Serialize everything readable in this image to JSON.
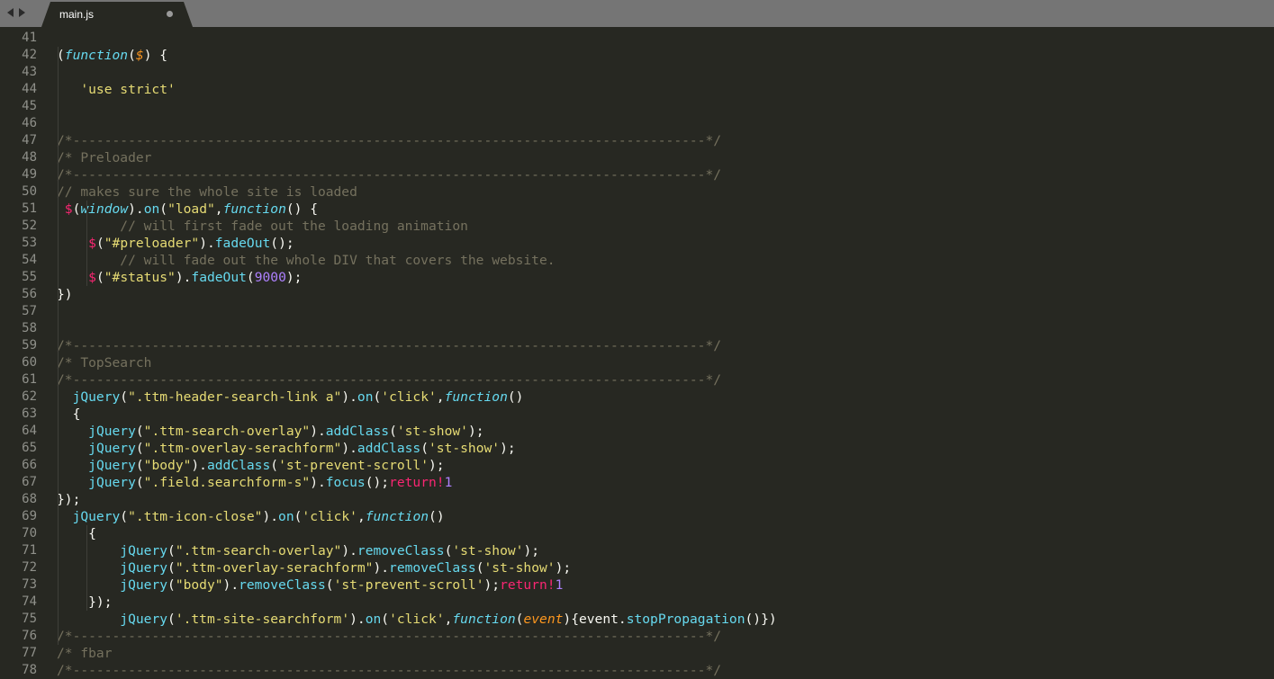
{
  "tab": {
    "title": "main.js",
    "modified_indicator": "●"
  },
  "nav": {
    "back_icon": "chevron-left-icon",
    "forward_icon": "chevron-right-icon"
  },
  "theme": {
    "background": "#272822",
    "tabbar": "#757575",
    "comment": "#75715e",
    "string": "#e6db74",
    "keyword": "#66d9ef",
    "operator": "#f92672",
    "number": "#ae81ff",
    "param": "#fd971f"
  },
  "lines": [
    {
      "n": "41",
      "tokens": []
    },
    {
      "n": "42",
      "tokens": [
        [
          "t",
          "("
        ],
        [
          "k",
          "function"
        ],
        [
          "t",
          "("
        ],
        [
          "p",
          "$"
        ],
        [
          "t",
          ") {"
        ]
      ]
    },
    {
      "n": "43",
      "tokens": []
    },
    {
      "n": "44",
      "tokens": [
        [
          "t",
          "   "
        ],
        [
          "s",
          "'use strict'"
        ]
      ]
    },
    {
      "n": "45",
      "tokens": []
    },
    {
      "n": "46",
      "tokens": []
    },
    {
      "n": "47",
      "tokens": [
        [
          "c",
          "/*--------------------------------------------------------------------------------*/"
        ]
      ]
    },
    {
      "n": "48",
      "tokens": [
        [
          "c",
          "/* Preloader"
        ]
      ]
    },
    {
      "n": "49",
      "tokens": [
        [
          "c",
          "/*--------------------------------------------------------------------------------*/"
        ]
      ]
    },
    {
      "n": "50",
      "tokens": [
        [
          "c",
          "// makes sure the whole site is loaded"
        ]
      ]
    },
    {
      "n": "51",
      "tokens": [
        [
          "t",
          " "
        ],
        [
          "o",
          "$"
        ],
        [
          "t",
          "("
        ],
        [
          "k",
          "window"
        ],
        [
          "t",
          ")."
        ],
        [
          "f",
          "on"
        ],
        [
          "t",
          "("
        ],
        [
          "s",
          "\"load\""
        ],
        [
          "t",
          ","
        ],
        [
          "k",
          "function"
        ],
        [
          "t",
          "() {"
        ]
      ]
    },
    {
      "n": "52",
      "tokens": [
        [
          "t",
          "        "
        ],
        [
          "c",
          "// will first fade out the loading animation"
        ]
      ]
    },
    {
      "n": "53",
      "tokens": [
        [
          "t",
          "    "
        ],
        [
          "o",
          "$"
        ],
        [
          "t",
          "("
        ],
        [
          "s",
          "\"#preloader\""
        ],
        [
          "t",
          ")."
        ],
        [
          "f",
          "fadeOut"
        ],
        [
          "t",
          "();"
        ]
      ]
    },
    {
      "n": "54",
      "tokens": [
        [
          "t",
          "        "
        ],
        [
          "c",
          "// will fade out the whole DIV that covers the website."
        ]
      ]
    },
    {
      "n": "55",
      "tokens": [
        [
          "t",
          "    "
        ],
        [
          "o",
          "$"
        ],
        [
          "t",
          "("
        ],
        [
          "s",
          "\"#status\""
        ],
        [
          "t",
          ")."
        ],
        [
          "f",
          "fadeOut"
        ],
        [
          "t",
          "("
        ],
        [
          "n",
          "9000"
        ],
        [
          "t",
          ");"
        ]
      ]
    },
    {
      "n": "56",
      "tokens": [
        [
          "t",
          "})"
        ]
      ]
    },
    {
      "n": "57",
      "tokens": []
    },
    {
      "n": "58",
      "tokens": []
    },
    {
      "n": "59",
      "tokens": [
        [
          "c",
          "/*--------------------------------------------------------------------------------*/"
        ]
      ]
    },
    {
      "n": "60",
      "tokens": [
        [
          "c",
          "/* TopSearch"
        ]
      ]
    },
    {
      "n": "61",
      "tokens": [
        [
          "c",
          "/*--------------------------------------------------------------------------------*/"
        ]
      ]
    },
    {
      "n": "62",
      "tokens": [
        [
          "t",
          "  "
        ],
        [
          "f",
          "jQuery"
        ],
        [
          "t",
          "("
        ],
        [
          "s",
          "\".ttm-header-search-link a\""
        ],
        [
          "t",
          ")."
        ],
        [
          "f",
          "on"
        ],
        [
          "t",
          "("
        ],
        [
          "s",
          "'click'"
        ],
        [
          "t",
          ","
        ],
        [
          "k",
          "function"
        ],
        [
          "t",
          "()"
        ]
      ]
    },
    {
      "n": "63",
      "tokens": [
        [
          "t",
          "  {"
        ]
      ]
    },
    {
      "n": "64",
      "tokens": [
        [
          "t",
          "    "
        ],
        [
          "f",
          "jQuery"
        ],
        [
          "t",
          "("
        ],
        [
          "s",
          "\".ttm-search-overlay\""
        ],
        [
          "t",
          ")."
        ],
        [
          "f",
          "addClass"
        ],
        [
          "t",
          "("
        ],
        [
          "s",
          "'st-show'"
        ],
        [
          "t",
          ");"
        ]
      ]
    },
    {
      "n": "65",
      "tokens": [
        [
          "t",
          "    "
        ],
        [
          "f",
          "jQuery"
        ],
        [
          "t",
          "("
        ],
        [
          "s",
          "\".ttm-overlay-serachform\""
        ],
        [
          "t",
          ")."
        ],
        [
          "f",
          "addClass"
        ],
        [
          "t",
          "("
        ],
        [
          "s",
          "'st-show'"
        ],
        [
          "t",
          ");"
        ]
      ]
    },
    {
      "n": "66",
      "tokens": [
        [
          "t",
          "    "
        ],
        [
          "f",
          "jQuery"
        ],
        [
          "t",
          "("
        ],
        [
          "s",
          "\"body\""
        ],
        [
          "t",
          ")."
        ],
        [
          "f",
          "addClass"
        ],
        [
          "t",
          "("
        ],
        [
          "s",
          "'st-prevent-scroll'"
        ],
        [
          "t",
          ");"
        ]
      ]
    },
    {
      "n": "67",
      "tokens": [
        [
          "t",
          "    "
        ],
        [
          "f",
          "jQuery"
        ],
        [
          "t",
          "("
        ],
        [
          "s",
          "\".field.searchform-s\""
        ],
        [
          "t",
          ")."
        ],
        [
          "f",
          "focus"
        ],
        [
          "t",
          "();"
        ],
        [
          "o",
          "return!"
        ],
        [
          "n",
          "1"
        ]
      ]
    },
    {
      "n": "68",
      "tokens": [
        [
          "t",
          "});"
        ]
      ]
    },
    {
      "n": "69",
      "tokens": [
        [
          "t",
          "  "
        ],
        [
          "f",
          "jQuery"
        ],
        [
          "t",
          "("
        ],
        [
          "s",
          "\".ttm-icon-close\""
        ],
        [
          "t",
          ")."
        ],
        [
          "f",
          "on"
        ],
        [
          "t",
          "("
        ],
        [
          "s",
          "'click'"
        ],
        [
          "t",
          ","
        ],
        [
          "k",
          "function"
        ],
        [
          "t",
          "()"
        ]
      ]
    },
    {
      "n": "70",
      "tokens": [
        [
          "t",
          "    {"
        ]
      ]
    },
    {
      "n": "71",
      "tokens": [
        [
          "t",
          "        "
        ],
        [
          "f",
          "jQuery"
        ],
        [
          "t",
          "("
        ],
        [
          "s",
          "\".ttm-search-overlay\""
        ],
        [
          "t",
          ")."
        ],
        [
          "f",
          "removeClass"
        ],
        [
          "t",
          "("
        ],
        [
          "s",
          "'st-show'"
        ],
        [
          "t",
          ");"
        ]
      ]
    },
    {
      "n": "72",
      "tokens": [
        [
          "t",
          "        "
        ],
        [
          "f",
          "jQuery"
        ],
        [
          "t",
          "("
        ],
        [
          "s",
          "\".ttm-overlay-serachform\""
        ],
        [
          "t",
          ")."
        ],
        [
          "f",
          "removeClass"
        ],
        [
          "t",
          "("
        ],
        [
          "s",
          "'st-show'"
        ],
        [
          "t",
          ");"
        ]
      ]
    },
    {
      "n": "73",
      "tokens": [
        [
          "t",
          "        "
        ],
        [
          "f",
          "jQuery"
        ],
        [
          "t",
          "("
        ],
        [
          "s",
          "\"body\""
        ],
        [
          "t",
          ")."
        ],
        [
          "f",
          "removeClass"
        ],
        [
          "t",
          "("
        ],
        [
          "s",
          "'st-prevent-scroll'"
        ],
        [
          "t",
          ");"
        ],
        [
          "o",
          "return!"
        ],
        [
          "n",
          "1"
        ]
      ]
    },
    {
      "n": "74",
      "tokens": [
        [
          "t",
          "    });"
        ]
      ]
    },
    {
      "n": "75",
      "tokens": [
        [
          "t",
          "        "
        ],
        [
          "f",
          "jQuery"
        ],
        [
          "t",
          "("
        ],
        [
          "s",
          "'.ttm-site-searchform'"
        ],
        [
          "t",
          ")."
        ],
        [
          "f",
          "on"
        ],
        [
          "t",
          "("
        ],
        [
          "s",
          "'click'"
        ],
        [
          "t",
          ","
        ],
        [
          "k",
          "function"
        ],
        [
          "t",
          "("
        ],
        [
          "p",
          "event"
        ],
        [
          "t",
          "){event."
        ],
        [
          "f",
          "stopPropagation"
        ],
        [
          "t",
          "()})"
        ]
      ]
    },
    {
      "n": "76",
      "tokens": [
        [
          "c",
          "/*--------------------------------------------------------------------------------*/"
        ]
      ]
    },
    {
      "n": "77",
      "tokens": [
        [
          "c",
          "/* fbar"
        ]
      ]
    },
    {
      "n": "78",
      "tokens": [
        [
          "c",
          "/*--------------------------------------------------------------------------------*/"
        ]
      ]
    }
  ]
}
